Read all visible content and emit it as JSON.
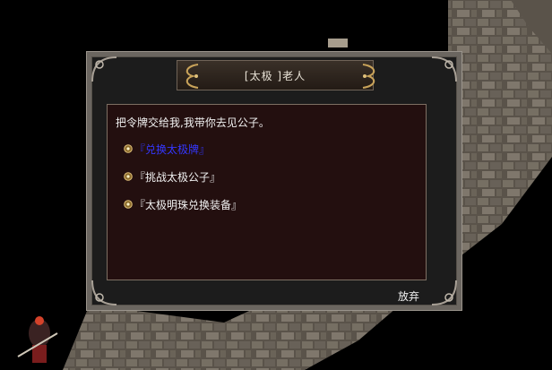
{
  "npc": {
    "title": "[太极 ]老人"
  },
  "dialog": {
    "message": "把令牌交给我,我带你去见公子。",
    "options": [
      {
        "label": "『兑换太极牌』",
        "active": true
      },
      {
        "label": "『挑战太极公子』",
        "active": false
      },
      {
        "label": "『太极明珠兑换装备』",
        "active": false
      }
    ],
    "quit_label": "放弃"
  },
  "colors": {
    "active_option": "#3437ff",
    "text": "#f0f0f0",
    "panel_bg": "#230f0f",
    "frame": "#6b6660"
  },
  "icons": {
    "option_bullet": "round-bullet-icon",
    "title_ornament": "dragon-ornament-icon",
    "corner": "frame-corner-icon",
    "character": "warrior-character-icon",
    "bridge": "stone-bridge-terrain"
  }
}
